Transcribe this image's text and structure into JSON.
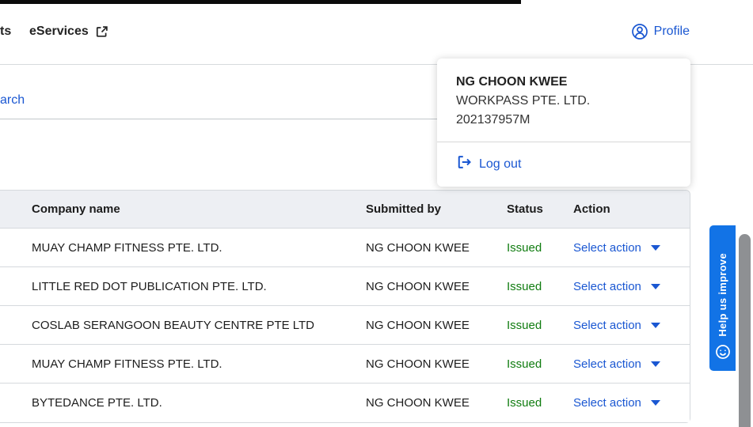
{
  "topbar": {
    "clipped_nav_item": "ts",
    "eservices_label": "eServices",
    "profile_label": "Profile"
  },
  "content": {
    "clipped_tab_label": "arch"
  },
  "profile_menu": {
    "user_name": "NG CHOON KWEE",
    "company_name": "WORKPASS PTE. LTD.",
    "uen": "202137957M",
    "logout_label": "Log out"
  },
  "table": {
    "headers": {
      "company": "Company name",
      "submitted_by": "Submitted by",
      "status": "Status",
      "action": "Action"
    },
    "rows": [
      {
        "company": "MUAY CHAMP FITNESS PTE. LTD.",
        "submitted_by": "NG CHOON KWEE",
        "status": "Issued",
        "action": "Select action"
      },
      {
        "company": "LITTLE RED DOT PUBLICATION PTE. LTD.",
        "submitted_by": "NG CHOON KWEE",
        "status": "Issued",
        "action": "Select action"
      },
      {
        "company": "COSLAB SERANGOON BEAUTY CENTRE PTE LTD",
        "submitted_by": "NG CHOON KWEE",
        "status": "Issued",
        "action": "Select action"
      },
      {
        "company": "MUAY CHAMP FITNESS PTE. LTD.",
        "submitted_by": "NG CHOON KWEE",
        "status": "Issued",
        "action": "Select action"
      },
      {
        "company": "BYTEDANCE PTE. LTD.",
        "submitted_by": "NG CHOON KWEE",
        "status": "Issued",
        "action": "Select action"
      }
    ]
  },
  "feedback": {
    "label": "Help us improve"
  },
  "colors": {
    "link_blue": "#1a57d2",
    "status_green": "#107c10",
    "feedback_blue": "#1273e6",
    "table_header_bg": "#edeff3"
  }
}
